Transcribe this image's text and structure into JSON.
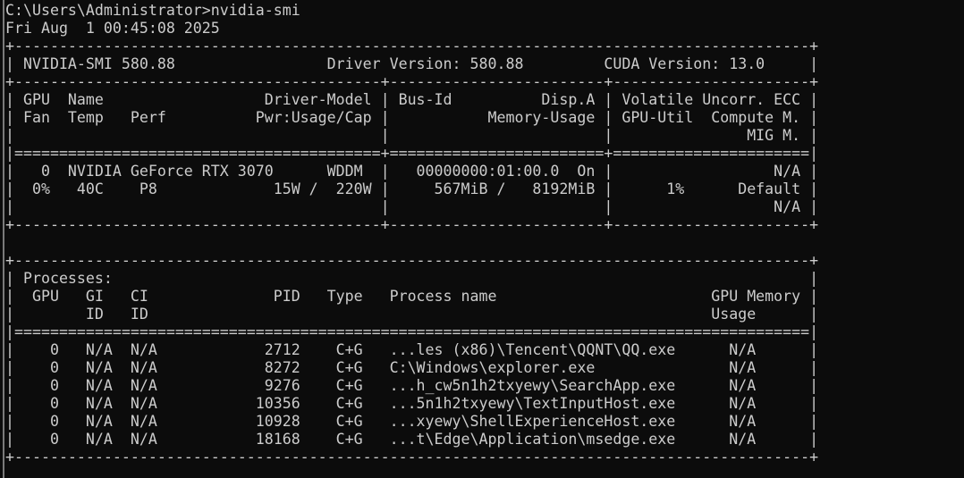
{
  "colors": {
    "background": "#0c0c0c",
    "foreground": "#cccccc"
  },
  "terminal": {
    "lines": [
      "C:\\Users\\Administrator>nvidia-smi",
      "Fri Aug  1 00:45:08 2025",
      "+-----------------------------------------------------------------------------------------+",
      "| NVIDIA-SMI 580.88                 Driver Version: 580.88         CUDA Version: 13.0     |",
      "+-----------------------------------------+------------------------+----------------------+",
      "| GPU  Name                  Driver-Model | Bus-Id          Disp.A | Volatile Uncorr. ECC |",
      "| Fan  Temp   Perf          Pwr:Usage/Cap |           Memory-Usage | GPU-Util  Compute M. |",
      "|                                         |                        |               MIG M. |",
      "|=========================================+========================+======================|",
      "|   0  NVIDIA GeForce RTX 3070      WDDM  |   00000000:01:00.0  On |                  N/A |",
      "|  0%   40C    P8             15W /  220W |     567MiB /   8192MiB |      1%      Default |",
      "|                                         |                        |                  N/A |",
      "+-----------------------------------------+------------------------+----------------------+",
      "",
      "+-----------------------------------------------------------------------------------------+",
      "| Processes:                                                                              |",
      "|  GPU   GI   CI              PID   Type   Process name                        GPU Memory |",
      "|        ID   ID                                                               Usage      |",
      "|=========================================================================================|",
      "|    0   N/A  N/A            2712    C+G   ...les (x86)\\Tencent\\QQNT\\QQ.exe      N/A      |",
      "|    0   N/A  N/A            8272    C+G   C:\\Windows\\explorer.exe               N/A      |",
      "|    0   N/A  N/A            9276    C+G   ...h_cw5n1h2txyewy\\SearchApp.exe      N/A      |",
      "|    0   N/A  N/A           10356    C+G   ...5n1h2txyewy\\TextInputHost.exe      N/A      |",
      "|    0   N/A  N/A           10928    C+G   ...xyewy\\ShellExperienceHost.exe      N/A      |",
      "|    0   N/A  N/A           18168    C+G   ...t\\Edge\\Application\\msedge.exe      N/A      |",
      "+-----------------------------------------------------------------------------------------+"
    ]
  }
}
